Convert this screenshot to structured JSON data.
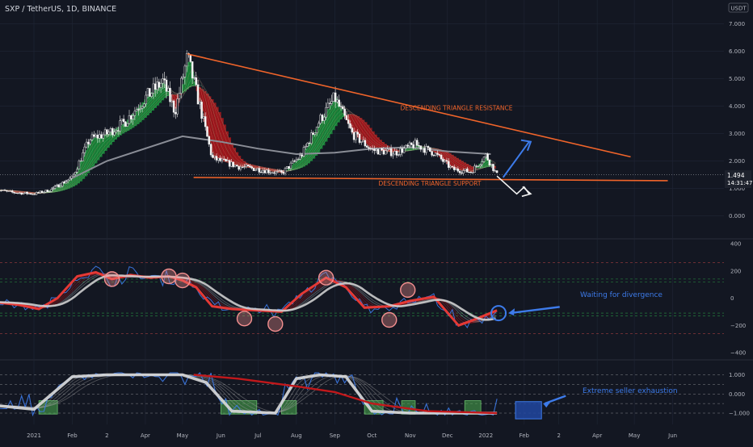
{
  "header": {
    "title": "SXP / TetherUS, 1D, BINANCE",
    "currency_badge": "USDT"
  },
  "price_tag": {
    "value": "1.494",
    "countdown": "14:31:47"
  },
  "colors": {
    "background": "#131722",
    "grid": "#1f2433",
    "text": "#b2b5be",
    "bull": "#26a69a",
    "bear": "#ef5350",
    "trendline": "#f0642a",
    "ribbon_green": "#1b9e3e",
    "ribbon_red": "#c2181b",
    "annotation_blue": "#3d7bea",
    "annotation_white": "#f2f2f2"
  },
  "chart_data": [
    {
      "type": "candlestick",
      "title": "SXP / TetherUS, 1D, BINANCE",
      "y_ticks": [
        "7.000",
        "6.000",
        "5.000",
        "4.000",
        "3.000",
        "2.000",
        "1.000",
        "0.000"
      ],
      "ylim": [
        -0.3,
        7.7
      ],
      "x_ticks": [
        "2021",
        "Feb",
        "Mar",
        "Apr",
        "May",
        "Jun",
        "Jul",
        "Aug",
        "Sep",
        "Oct",
        "Nov",
        "Dec",
        "2022",
        "Feb",
        "Mar",
        "Apr",
        "May",
        "Jun"
      ],
      "x_tick_labels": [
        "2021",
        "Feb",
        "2",
        "Apr",
        "May",
        "Jun",
        "Jul",
        "Aug",
        "Sep",
        "Oct",
        "Nov",
        "Dec",
        "2022",
        "Feb",
        "2",
        "Apr",
        "May",
        "Jun"
      ],
      "close_path": [
        [
          "2020-12-01",
          0.95
        ],
        [
          "2020-12-15",
          0.85
        ],
        [
          "2021-01-01",
          0.8
        ],
        [
          "2021-01-15",
          0.95
        ],
        [
          "2021-02-01",
          1.4
        ],
        [
          "2021-02-15",
          2.8
        ],
        [
          "2021-03-01",
          3.0
        ],
        [
          "2021-03-15",
          3.4
        ],
        [
          "2021-04-01",
          4.3
        ],
        [
          "2021-04-15",
          4.9
        ],
        [
          "2021-04-25",
          3.8
        ],
        [
          "2021-05-05",
          5.8
        ],
        [
          "2021-05-15",
          4.0
        ],
        [
          "2021-05-25",
          2.1
        ],
        [
          "2021-06-15",
          1.8
        ],
        [
          "2021-07-01",
          1.7
        ],
        [
          "2021-07-20",
          1.55
        ],
        [
          "2021-08-05",
          2.2
        ],
        [
          "2021-08-20",
          3.5
        ],
        [
          "2021-09-01",
          4.3
        ],
        [
          "2021-09-15",
          3.0
        ],
        [
          "2021-10-01",
          2.4
        ],
        [
          "2021-10-20",
          2.3
        ],
        [
          "2021-11-05",
          2.6
        ],
        [
          "2021-11-20",
          2.3
        ],
        [
          "2021-12-05",
          1.7
        ],
        [
          "2021-12-20",
          1.6
        ],
        [
          "2022-01-01",
          2.2
        ],
        [
          "2022-01-10",
          1.494
        ]
      ],
      "moving_average_path": [
        [
          "2021-01-15",
          1.0
        ],
        [
          "2021-03-01",
          2.0
        ],
        [
          "2021-05-01",
          2.9
        ],
        [
          "2021-06-01",
          2.7
        ],
        [
          "2021-07-01",
          2.45
        ],
        [
          "2021-08-01",
          2.25
        ],
        [
          "2021-09-01",
          2.3
        ],
        [
          "2021-10-01",
          2.45
        ],
        [
          "2021-11-01",
          2.5
        ],
        [
          "2021-12-01",
          2.35
        ],
        [
          "2022-01-05",
          2.25
        ]
      ],
      "last_price": 1.494,
      "annotations": [
        {
          "label": "DESCENDING TRIANGLE RESISTANCE",
          "from": [
            "2021-05-05",
            5.9
          ],
          "to": [
            "2022-04-28",
            2.15
          ]
        },
        {
          "label": "DESCENDING TRIANGLE SUPPORT",
          "from": [
            "2021-05-10",
            1.4
          ],
          "to": [
            "2022-05-28",
            1.28
          ]
        }
      ],
      "projection_up": [
        [
          "2022-01-15",
          1.4
        ],
        [
          "2022-02-05",
          2.7
        ]
      ],
      "projection_down": [
        [
          "2022-01-10",
          1.45
        ],
        [
          "2022-01-26",
          0.8
        ],
        [
          "2022-02-01",
          1.05
        ],
        [
          "2022-02-05",
          0.8
        ]
      ]
    },
    {
      "type": "line",
      "title": "",
      "y_ticks": [
        "400",
        "200",
        "0",
        "−200",
        "−400"
      ],
      "ylim": [
        -430,
        430
      ],
      "reference_levels": [
        260,
        140,
        120,
        -110,
        -130,
        -260
      ],
      "main_path": [
        [
          "2020-12-01",
          -30
        ],
        [
          "2020-12-20",
          -50
        ],
        [
          "2021-01-05",
          -80
        ],
        [
          "2021-01-20",
          0
        ],
        [
          "2021-02-05",
          160
        ],
        [
          "2021-02-20",
          190
        ],
        [
          "2021-03-05",
          140
        ],
        [
          "2021-03-20",
          170
        ],
        [
          "2021-04-05",
          150
        ],
        [
          "2021-04-20",
          160
        ],
        [
          "2021-05-01",
          130
        ],
        [
          "2021-05-12",
          80
        ],
        [
          "2021-05-25",
          -60
        ],
        [
          "2021-06-10",
          -80
        ],
        [
          "2021-07-01",
          -90
        ],
        [
          "2021-07-20",
          -100
        ],
        [
          "2021-08-05",
          30
        ],
        [
          "2021-08-25",
          150
        ],
        [
          "2021-09-10",
          80
        ],
        [
          "2021-09-25",
          -70
        ],
        [
          "2021-10-15",
          -60
        ],
        [
          "2021-11-01",
          -20
        ],
        [
          "2021-11-20",
          10
        ],
        [
          "2021-12-10",
          -200
        ],
        [
          "2021-12-25",
          -150
        ],
        [
          "2022-01-10",
          -90
        ]
      ],
      "circled_points": [
        [
          "2021-03-05",
          140
        ],
        [
          "2021-04-20",
          160
        ],
        [
          "2021-05-01",
          130
        ],
        [
          "2021-06-20",
          -150
        ],
        [
          "2021-07-15",
          -190
        ],
        [
          "2021-08-25",
          150
        ],
        [
          "2021-10-15",
          -160
        ],
        [
          "2021-10-30",
          60
        ]
      ],
      "annotation": {
        "label": "Waiting for divergence",
        "at": [
          "2022-01-15",
          -100
        ]
      }
    },
    {
      "type": "line",
      "title": "",
      "y_ticks": [
        "1.000",
        "0.000",
        "−1.000"
      ],
      "ylim": [
        -1.3,
        1.5
      ],
      "reference_levels": [
        1.0,
        0.5,
        0.0,
        -0.5,
        -1.0
      ],
      "main_path": [
        [
          "2020-12-01",
          -0.6
        ],
        [
          "2021-01-01",
          -0.8
        ],
        [
          "2021-02-01",
          0.9
        ],
        [
          "2021-03-01",
          1.0
        ],
        [
          "2021-04-01",
          1.0
        ],
        [
          "2021-05-01",
          1.0
        ],
        [
          "2021-05-20",
          0.6
        ],
        [
          "2021-06-10",
          -0.9
        ],
        [
          "2021-07-15",
          -1.0
        ],
        [
          "2021-08-01",
          0.8
        ],
        [
          "2021-08-20",
          1.0
        ],
        [
          "2021-09-10",
          0.9
        ],
        [
          "2021-10-01",
          -0.9
        ],
        [
          "2021-11-01",
          -1.0
        ],
        [
          "2021-12-01",
          -1.0
        ],
        [
          "2022-01-10",
          -1.0
        ]
      ],
      "bearish_path": [
        [
          "2021-05-10",
          1.0
        ],
        [
          "2021-06-15",
          0.8
        ],
        [
          "2021-08-01",
          0.4
        ],
        [
          "2021-09-01",
          0.1
        ],
        [
          "2021-10-01",
          -0.5
        ],
        [
          "2021-11-15",
          -0.9
        ],
        [
          "2022-01-10",
          -1.0
        ]
      ],
      "exhaustion_zones": [
        [
          "2021-01-05",
          "2021-01-20"
        ],
        [
          "2021-06-01",
          "2021-06-30"
        ],
        [
          "2021-07-20",
          "2021-08-01"
        ],
        [
          "2021-09-25",
          "2021-10-10"
        ],
        [
          "2021-10-25",
          "2021-11-05"
        ],
        [
          "2021-12-15",
          "2021-12-28"
        ]
      ],
      "highlight_zone": [
        "2022-01-25",
        "2022-02-15"
      ],
      "annotation": {
        "label": "Extreme seller exhaustion",
        "at": [
          "2022-02-15",
          -0.1
        ]
      }
    }
  ]
}
